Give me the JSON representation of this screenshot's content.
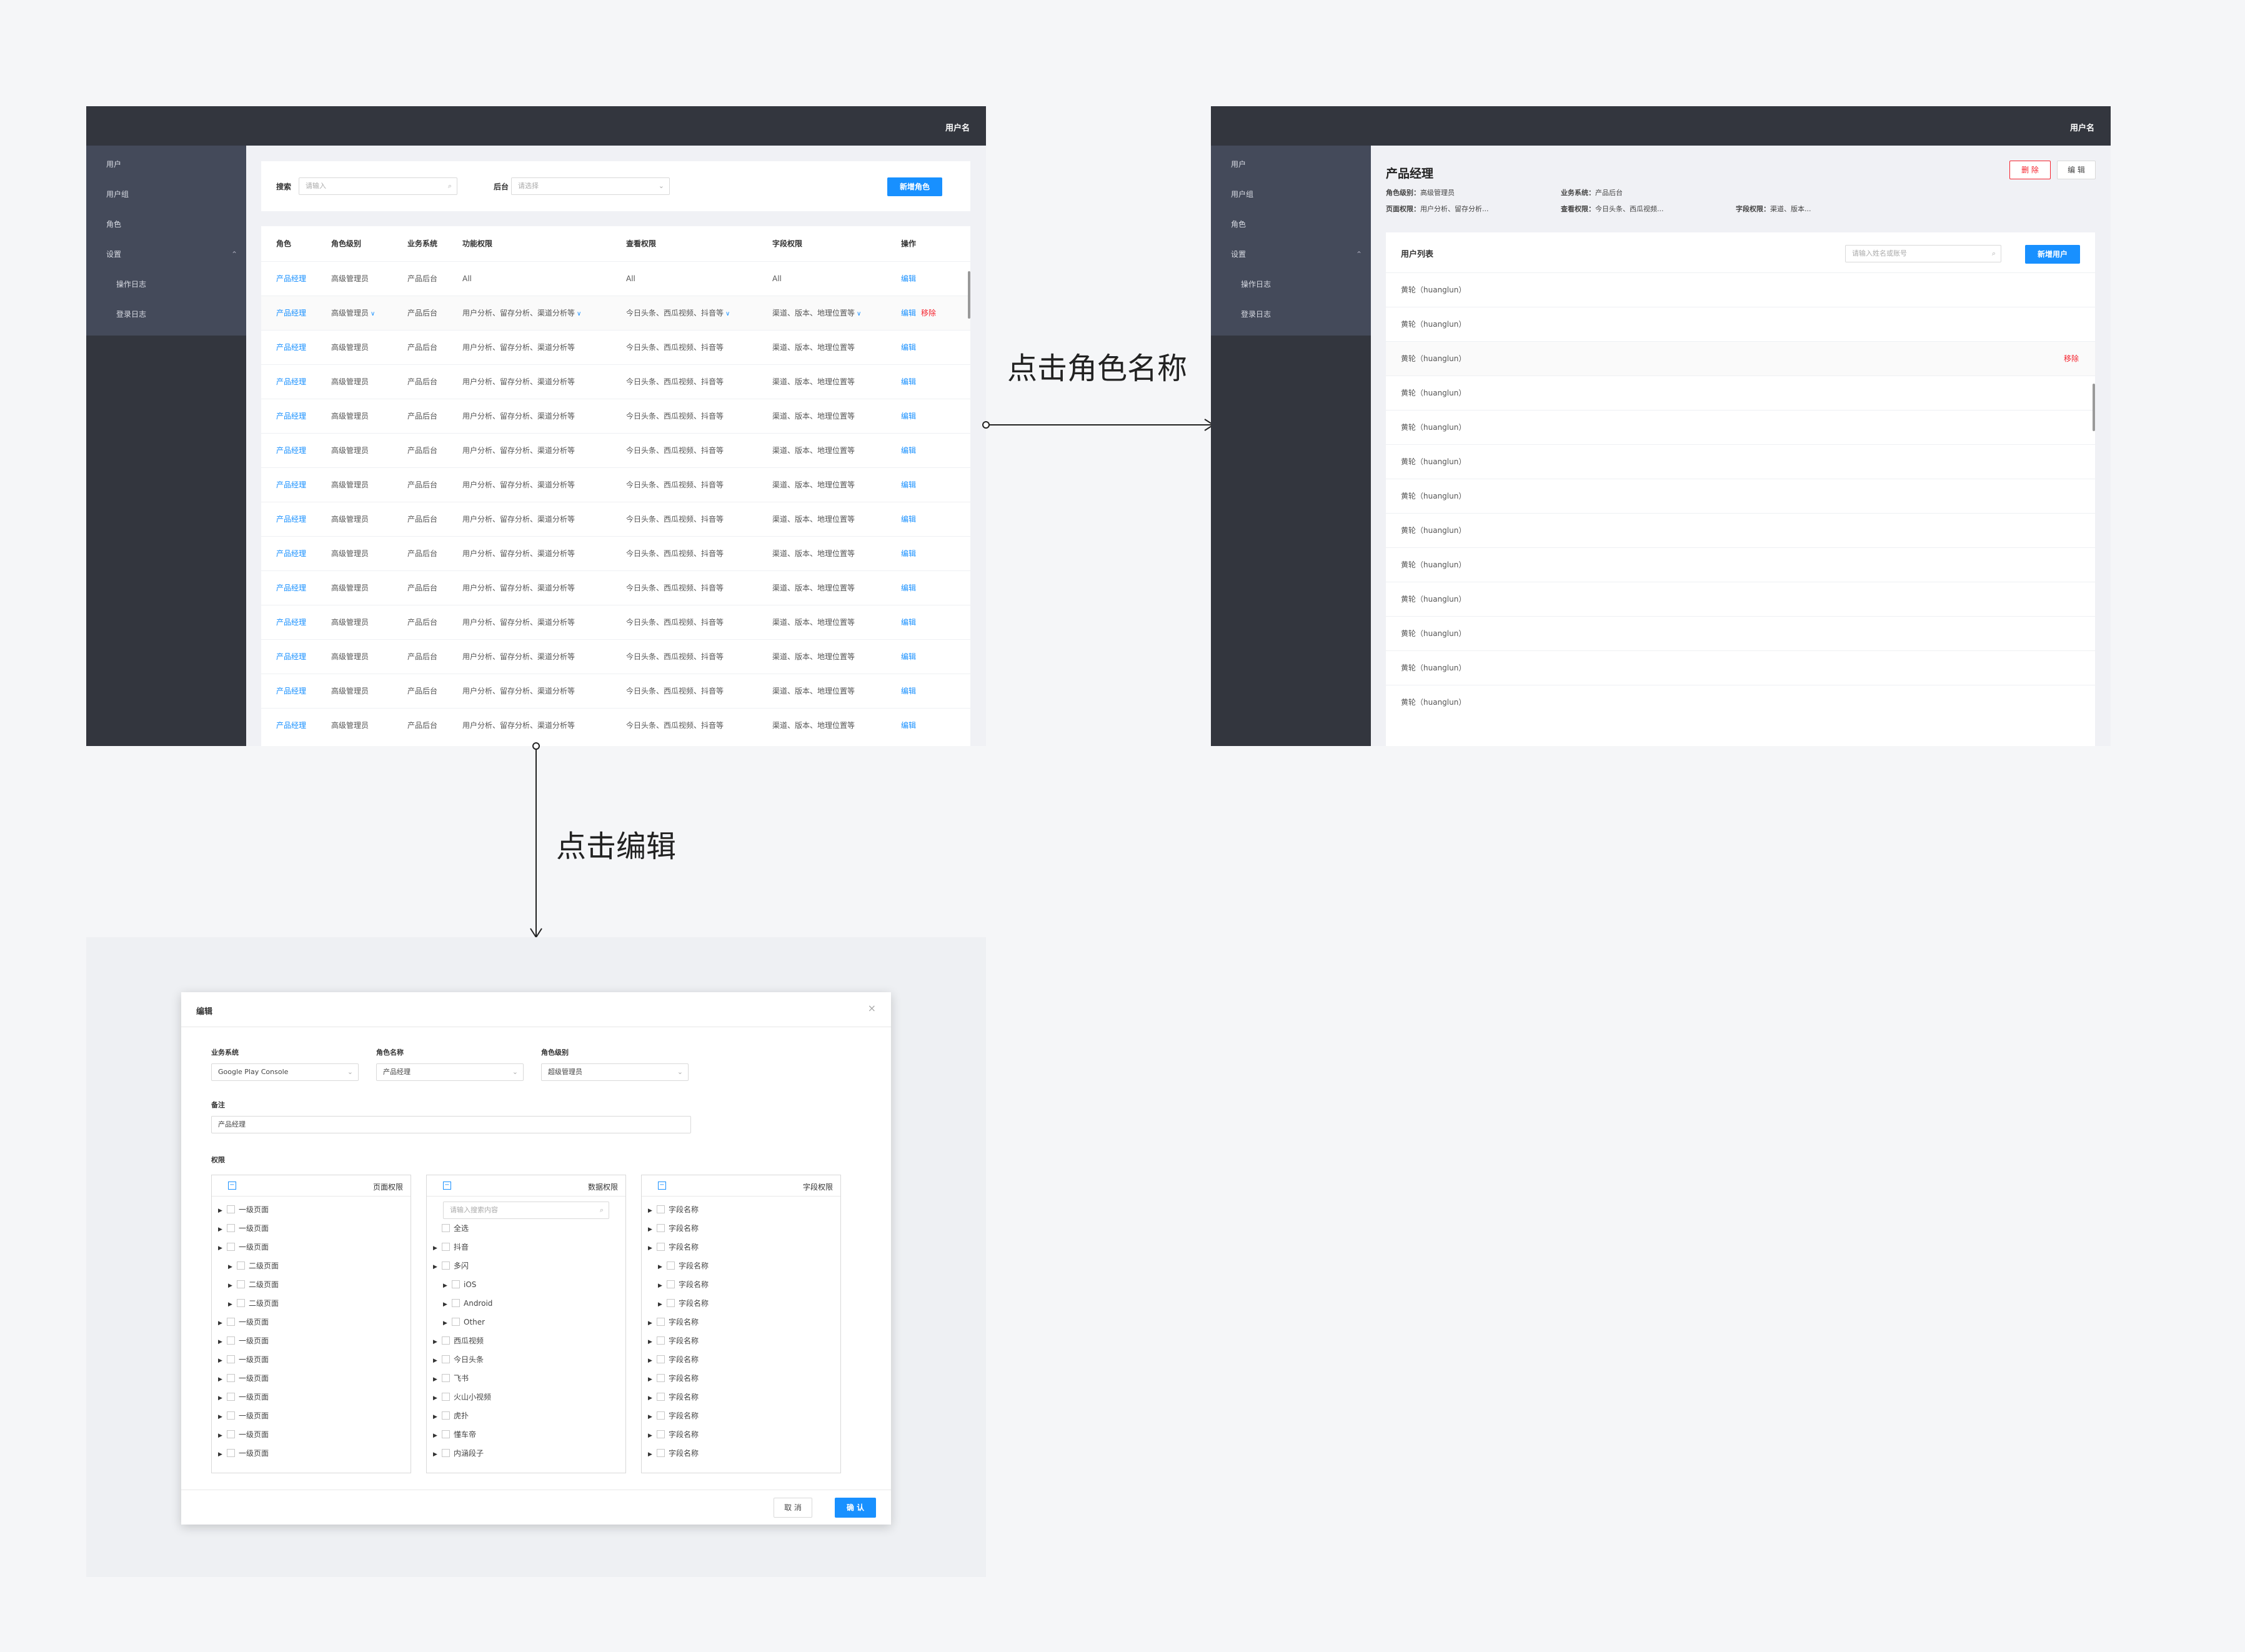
{
  "username": "用户名",
  "sidebar": {
    "items": [
      {
        "label": "用户"
      },
      {
        "label": "用户组"
      },
      {
        "label": "角色"
      },
      {
        "label": "设置"
      },
      {
        "label": "操作日志"
      },
      {
        "label": "登录日志"
      }
    ]
  },
  "list_page": {
    "search_label": "搜索",
    "search_placeholder": "请输入",
    "backend_label": "后台",
    "backend_placeholder": "请选择",
    "new_role_button": "新增角色",
    "columns": [
      "角色",
      "角色级别",
      "业务系统",
      "功能权限",
      "查看权限",
      "字段权限",
      "操作"
    ],
    "rows": [
      {
        "role": "产品经理",
        "level": "高级管理员",
        "system": "产品后台",
        "func": "All",
        "view": "All",
        "field": "All",
        "caret": "",
        "remove": ""
      },
      {
        "role": "产品经理",
        "level": "高级管理员",
        "system": "产品后台",
        "func": "用户分析、留存分析、渠道分析等",
        "view": "今日头条、西瓜视频、抖音等",
        "field": "渠道、版本、地理位置等",
        "caret": "∨",
        "remove": "移除"
      },
      {
        "role": "产品经理",
        "level": "高级管理员",
        "system": "产品后台",
        "func": "用户分析、留存分析、渠道分析等",
        "view": "今日头条、西瓜视频、抖音等",
        "field": "渠道、版本、地理位置等",
        "caret": "",
        "remove": ""
      },
      {
        "role": "产品经理",
        "level": "高级管理员",
        "system": "产品后台",
        "func": "用户分析、留存分析、渠道分析等",
        "view": "今日头条、西瓜视频、抖音等",
        "field": "渠道、版本、地理位置等",
        "caret": "",
        "remove": ""
      },
      {
        "role": "产品经理",
        "level": "高级管理员",
        "system": "产品后台",
        "func": "用户分析、留存分析、渠道分析等",
        "view": "今日头条、西瓜视频、抖音等",
        "field": "渠道、版本、地理位置等",
        "caret": "",
        "remove": ""
      },
      {
        "role": "产品经理",
        "level": "高级管理员",
        "system": "产品后台",
        "func": "用户分析、留存分析、渠道分析等",
        "view": "今日头条、西瓜视频、抖音等",
        "field": "渠道、版本、地理位置等",
        "caret": "",
        "remove": ""
      },
      {
        "role": "产品经理",
        "level": "高级管理员",
        "system": "产品后台",
        "func": "用户分析、留存分析、渠道分析等",
        "view": "今日头条、西瓜视频、抖音等",
        "field": "渠道、版本、地理位置等",
        "caret": "",
        "remove": ""
      },
      {
        "role": "产品经理",
        "level": "高级管理员",
        "system": "产品后台",
        "func": "用户分析、留存分析、渠道分析等",
        "view": "今日头条、西瓜视频、抖音等",
        "field": "渠道、版本、地理位置等",
        "caret": "",
        "remove": ""
      },
      {
        "role": "产品经理",
        "level": "高级管理员",
        "system": "产品后台",
        "func": "用户分析、留存分析、渠道分析等",
        "view": "今日头条、西瓜视频、抖音等",
        "field": "渠道、版本、地理位置等",
        "caret": "",
        "remove": ""
      },
      {
        "role": "产品经理",
        "level": "高级管理员",
        "system": "产品后台",
        "func": "用户分析、留存分析、渠道分析等",
        "view": "今日头条、西瓜视频、抖音等",
        "field": "渠道、版本、地理位置等",
        "caret": "",
        "remove": ""
      },
      {
        "role": "产品经理",
        "level": "高级管理员",
        "system": "产品后台",
        "func": "用户分析、留存分析、渠道分析等",
        "view": "今日头条、西瓜视频、抖音等",
        "field": "渠道、版本、地理位置等",
        "caret": "",
        "remove": ""
      },
      {
        "role": "产品经理",
        "level": "高级管理员",
        "system": "产品后台",
        "func": "用户分析、留存分析、渠道分析等",
        "view": "今日头条、西瓜视频、抖音等",
        "field": "渠道、版本、地理位置等",
        "caret": "",
        "remove": ""
      },
      {
        "role": "产品经理",
        "level": "高级管理员",
        "system": "产品后台",
        "func": "用户分析、留存分析、渠道分析等",
        "view": "今日头条、西瓜视频、抖音等",
        "field": "渠道、版本、地理位置等",
        "caret": "",
        "remove": ""
      },
      {
        "role": "产品经理",
        "level": "高级管理员",
        "system": "产品后台",
        "func": "用户分析、留存分析、渠道分析等",
        "view": "今日头条、西瓜视频、抖音等",
        "field": "渠道、版本、地理位置等",
        "caret": "",
        "remove": ""
      }
    ],
    "edit_label": "编辑"
  },
  "annotations": {
    "click_role_name": "点击角色名称",
    "click_edit": "点击编辑"
  },
  "detail_page": {
    "title": "产品经理",
    "delete_button": "删 除",
    "edit_button": "编 辑",
    "meta": [
      {
        "label": "角色级别：",
        "value": "高级管理员"
      },
      {
        "label": "业务系统：",
        "value": "产品后台"
      },
      {
        "label": "页面权限：",
        "value": "用户分析、留存分析..."
      },
      {
        "label": "查看权限：",
        "value": "今日头条、西瓜视频..."
      },
      {
        "label": "字段权限：",
        "value": "渠道、版本..."
      }
    ],
    "user_list_title": "用户列表",
    "user_search_placeholder": "请输入姓名或账号",
    "new_user_button": "新增用户",
    "users": [
      "黄轮（huanglun）",
      "黄轮（huanglun）",
      "黄轮（huanglun）",
      "黄轮（huanglun）",
      "黄轮（huanglun）",
      "黄轮（huanglun）",
      "黄轮（huanglun）",
      "黄轮（huanglun）",
      "黄轮（huanglun）",
      "黄轮（huanglun）",
      "黄轮（huanglun）",
      "黄轮（huanglun）",
      "黄轮（huanglun）"
    ],
    "remove_label": "移除"
  },
  "edit_modal": {
    "title": "编辑",
    "close_icon": "close-icon",
    "business_system_label": "业务系统",
    "business_system_value": "Google Play Console",
    "role_name_label": "角色名称",
    "role_name_value": "产品经理",
    "role_level_label": "角色级别",
    "role_level_value": "超级管理员",
    "remark_label": "备注",
    "remark_value": "产品经理",
    "permission_label": "权限",
    "page_perm": {
      "title": "页面权限",
      "items": [
        {
          "label": "一级页面",
          "depth": 0
        },
        {
          "label": "一级页面",
          "depth": 0
        },
        {
          "label": "一级页面",
          "depth": 0
        },
        {
          "label": "二级页面",
          "depth": 1
        },
        {
          "label": "二级页面",
          "depth": 1
        },
        {
          "label": "二级页面",
          "depth": 1
        },
        {
          "label": "一级页面",
          "depth": 0
        },
        {
          "label": "一级页面",
          "depth": 0
        },
        {
          "label": "一级页面",
          "depth": 0
        },
        {
          "label": "一级页面",
          "depth": 0
        },
        {
          "label": "一级页面",
          "depth": 0
        },
        {
          "label": "一级页面",
          "depth": 0
        },
        {
          "label": "一级页面",
          "depth": 0
        },
        {
          "label": "一级页面",
          "depth": 0
        }
      ]
    },
    "data_perm": {
      "title": "数据权限",
      "search_placeholder": "请输入搜索内容",
      "items": [
        {
          "label": "全选",
          "depth": 0,
          "noarrow": true
        },
        {
          "label": "抖音",
          "depth": 0
        },
        {
          "label": "多闪",
          "depth": 0
        },
        {
          "label": "iOS",
          "depth": 1
        },
        {
          "label": "Android",
          "depth": 1
        },
        {
          "label": "Other",
          "depth": 1
        },
        {
          "label": "西瓜视频",
          "depth": 0
        },
        {
          "label": "今日头条",
          "depth": 0
        },
        {
          "label": "飞书",
          "depth": 0
        },
        {
          "label": "火山小视频",
          "depth": 0
        },
        {
          "label": "虎扑",
          "depth": 0
        },
        {
          "label": "懂车帝",
          "depth": 0
        },
        {
          "label": "内涵段子",
          "depth": 0
        }
      ]
    },
    "field_perm": {
      "title": "字段权限",
      "items": [
        {
          "label": "字段名称",
          "depth": 0
        },
        {
          "label": "字段名称",
          "depth": 0
        },
        {
          "label": "字段名称",
          "depth": 0
        },
        {
          "label": "字段名称",
          "depth": 1
        },
        {
          "label": "字段名称",
          "depth": 1
        },
        {
          "label": "字段名称",
          "depth": 1
        },
        {
          "label": "字段名称",
          "depth": 0
        },
        {
          "label": "字段名称",
          "depth": 0
        },
        {
          "label": "字段名称",
          "depth": 0
        },
        {
          "label": "字段名称",
          "depth": 0
        },
        {
          "label": "字段名称",
          "depth": 0
        },
        {
          "label": "字段名称",
          "depth": 0
        },
        {
          "label": "字段名称",
          "depth": 0
        },
        {
          "label": "字段名称",
          "depth": 0
        }
      ]
    },
    "cancel_button": "取 消",
    "confirm_button": "确 认"
  }
}
